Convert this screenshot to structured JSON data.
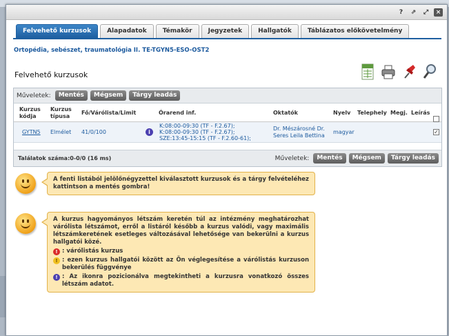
{
  "window": {
    "help": "?",
    "restore": "⇗",
    "maximize": "⤢",
    "close": "×"
  },
  "tabs": [
    {
      "label": "Felvehető kurzusok",
      "active": true
    },
    {
      "label": "Alapadatok"
    },
    {
      "label": "Témakör"
    },
    {
      "label": "Jegyzetek"
    },
    {
      "label": "Hallgatók"
    },
    {
      "label": "Táblázatos előkövetelmény"
    }
  ],
  "subject": "Ortopédia, sebészet, traumatológia II. TE-TGYN5-ESO-OST2",
  "page_title": "Felvehető kurzusok",
  "toolbar_icons": [
    "excel-export-icon",
    "print-icon",
    "pin-icon",
    "search-icon"
  ],
  "ops": {
    "label": "Műveletek:",
    "save": "Mentés",
    "cancel": "Mégsem",
    "drop": "Tárgy leadás"
  },
  "table": {
    "headers": {
      "code": "Kurzus kódja",
      "type": "Kurzus típusa",
      "capacity": "Fő/Várólista/Limit",
      "schedule": "Órarend inf.",
      "teachers": "Oktatók",
      "language": "Nyelv",
      "site": "Telephely",
      "note": "Megj.",
      "desc": "Leírás"
    },
    "rows": [
      {
        "code": "GYTN5",
        "type": "Elmélet",
        "capacity": "41/0/100",
        "schedule": [
          "K:08:00-09:30 (TF - F.2.67);",
          "K:08:00-09:30 (TF - F.2.67);",
          "SZE:13:45-15:15 (TF - F.2.60-61);"
        ],
        "teachers": [
          "Dr. Mészárosné Dr.",
          "Seres Leila Bettina"
        ],
        "language": "magyar",
        "checked": true
      }
    ],
    "count": "Találatok száma:0-0/0 (16 ms)"
  },
  "tips": {
    "tip1": "A fenti listából jelölőnégyzettel kiválasztott kurzusok és a tárgy felvételéhez kattintson a mentés gombra!",
    "tip2": "A kurzus hagyományos létszám keretén túl az intézmény meghatározhat várólista létszámot, erről a listáról később a kurzus valódi, vagy maximális létszámkeretének esetleges változásával lehetősége van bekerülni a kurzus hallgatói közé.",
    "legend": [
      {
        "color": "red",
        "symbol": "!",
        "text": ": várólistás kurzus"
      },
      {
        "color": "yellow",
        "symbol": "!",
        "text": ": ezen kurzus hallgatói között az Ön véglegesítése a várólistás kurzuson bekerülés függvénye"
      },
      {
        "color": "blue",
        "symbol": "!",
        "text": ": Az ikonra pozicionálva megtekintheti a kurzusra vonatkozó összes létszám adatot."
      }
    ]
  }
}
